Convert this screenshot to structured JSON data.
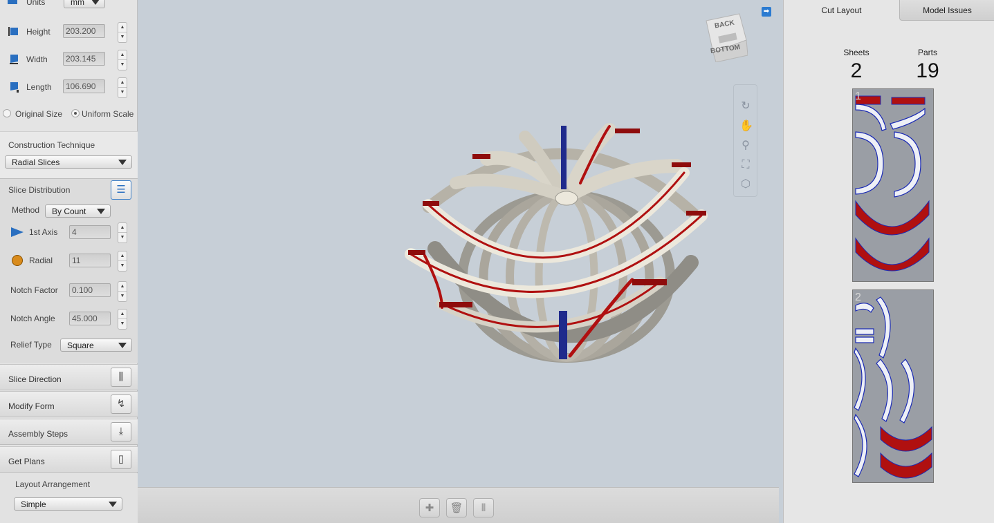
{
  "left": {
    "units_label": "Units",
    "units_value": "mm",
    "height_label": "Height",
    "height_value": "203.200",
    "width_label": "Width",
    "width_value": "203.145",
    "length_label": "Length",
    "length_value": "106.690",
    "original_size": "Original Size",
    "uniform_scale": "Uniform Scale",
    "construction_label": "Construction Technique",
    "construction_value": "Radial Slices",
    "slice_distribution": "Slice Distribution",
    "method_label": "Method",
    "method_value": "By Count",
    "axis1_label": "1st Axis",
    "axis1_value": "4",
    "radial_label": "Radial",
    "radial_value": "11",
    "notch_factor_label": "Notch Factor",
    "notch_factor_value": "0.100",
    "notch_angle_label": "Notch Angle",
    "notch_angle_value": "45.000",
    "relief_label": "Relief Type",
    "relief_value": "Square",
    "slice_direction": "Slice Direction",
    "modify_form": "Modify Form",
    "assembly_steps": "Assembly Steps",
    "get_plans": "Get Plans",
    "layout_label": "Layout Arrangement",
    "layout_value": "Simple"
  },
  "view": {
    "cube_back": "BACK",
    "cube_bottom": "BOTTOM"
  },
  "right": {
    "tab_cut_layout": "Cut Layout",
    "tab_model_issues": "Model Issues",
    "sheets_label": "Sheets",
    "sheets_value": "2",
    "parts_label": "Parts",
    "parts_value": "19",
    "sheet1_num": "1",
    "sheet2_num": "2"
  },
  "colors": {
    "slice_red": "#b01010",
    "slice_face": "#ece8dc",
    "axis_blue": "#1f2a8c",
    "accent": "#2b7bd1"
  }
}
